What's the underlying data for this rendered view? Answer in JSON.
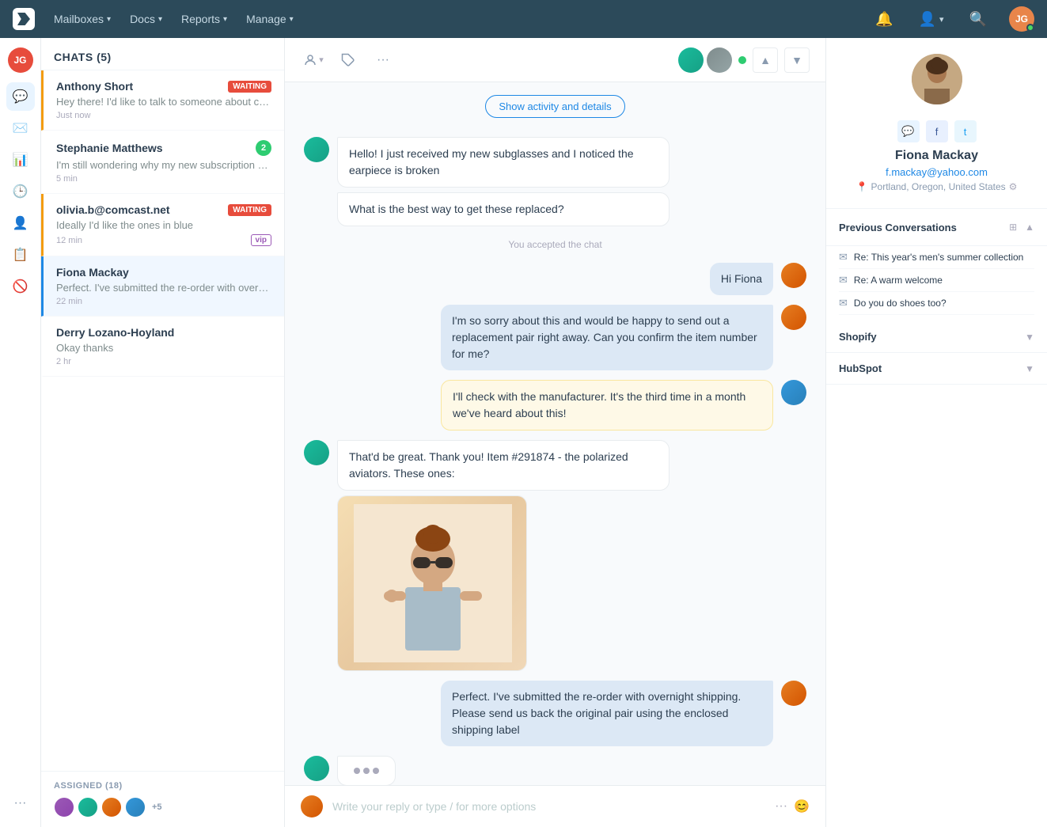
{
  "nav": {
    "logo_text": "JG",
    "items": [
      {
        "label": "Mailboxes",
        "has_chevron": true
      },
      {
        "label": "Docs",
        "has_chevron": true
      },
      {
        "label": "Reports",
        "has_chevron": true
      },
      {
        "label": "Manage",
        "has_chevron": true
      }
    ]
  },
  "chat_list": {
    "title": "CHATS",
    "count": "5",
    "items": [
      {
        "name": "Anthony Short",
        "preview": "Hey there! I'd like to talk to someone about cancelling my account :(",
        "time": "Just now",
        "status": "WAITING",
        "unread": null,
        "vip": false,
        "indicator": "waiting"
      },
      {
        "name": "Stephanie Matthews",
        "preview": "I'm still wondering why my new subscription didn't renew at the end...",
        "time": "5 min",
        "status": null,
        "unread": "2",
        "vip": false,
        "indicator": "unread"
      },
      {
        "name": "olivia.b@comcast.net",
        "preview": "Ideally I'd like the ones in blue",
        "time": "12 min",
        "status": "WAITING",
        "unread": null,
        "vip": true,
        "indicator": "waiting"
      },
      {
        "name": "Fiona Mackay",
        "preview": "Perfect. I've submitted the re-order with overnight shipping. Please send...",
        "time": "22 min",
        "status": null,
        "unread": null,
        "vip": false,
        "indicator": "active"
      },
      {
        "name": "Derry Lozano-Hoyland",
        "preview": "Okay thanks",
        "time": "2 hr",
        "status": null,
        "unread": null,
        "vip": false,
        "indicator": "none"
      }
    ],
    "assigned": {
      "label": "ASSIGNED",
      "count": "18",
      "more": "+5"
    }
  },
  "chat_toolbar": {
    "more_label": "···"
  },
  "activity_btn_label": "Show activity and details",
  "messages": [
    {
      "type": "incoming",
      "text": "Hello! I just received my new subglasses and I noticed the earpiece is broken",
      "has_avatar": true
    },
    {
      "type": "incoming",
      "text": "What is the best way to get these replaced?",
      "has_avatar": false
    },
    {
      "type": "system",
      "text": "You accepted the chat"
    },
    {
      "type": "outgoing",
      "text": "Hi Fiona"
    },
    {
      "type": "outgoing",
      "text": "I'm so sorry about this and would be happy to send out a replacement pair right away. Can you confirm the item number for me?"
    },
    {
      "type": "note",
      "text": "I'll check with the manufacturer. It's the third time in a month we've heard about this!"
    },
    {
      "type": "incoming",
      "text": "That'd be great. Thank you! Item #291874 - the polarized aviators. These ones:",
      "has_avatar": true,
      "has_image": true
    },
    {
      "type": "outgoing",
      "text": "Perfect. I've submitted the re-order with overnight shipping. Please send us back the original pair using the enclosed shipping label"
    },
    {
      "type": "typing",
      "has_avatar": true
    }
  ],
  "reply_input": {
    "placeholder": "Write your reply or type / for more options"
  },
  "right_panel": {
    "contact": {
      "name": "Fiona Mackay",
      "email": "f.mackay@yahoo.com",
      "location": "Portland, Oregon, United States"
    },
    "previous_conversations": {
      "title": "Previous Conversations",
      "items": [
        {
          "text": "Re: This year's men's summer collection"
        },
        {
          "text": "Re: A warm welcome"
        },
        {
          "text": "Do you do shoes too?"
        }
      ]
    },
    "shopify": {
      "title": "Shopify"
    },
    "hubspot": {
      "title": "HubSpot"
    }
  }
}
